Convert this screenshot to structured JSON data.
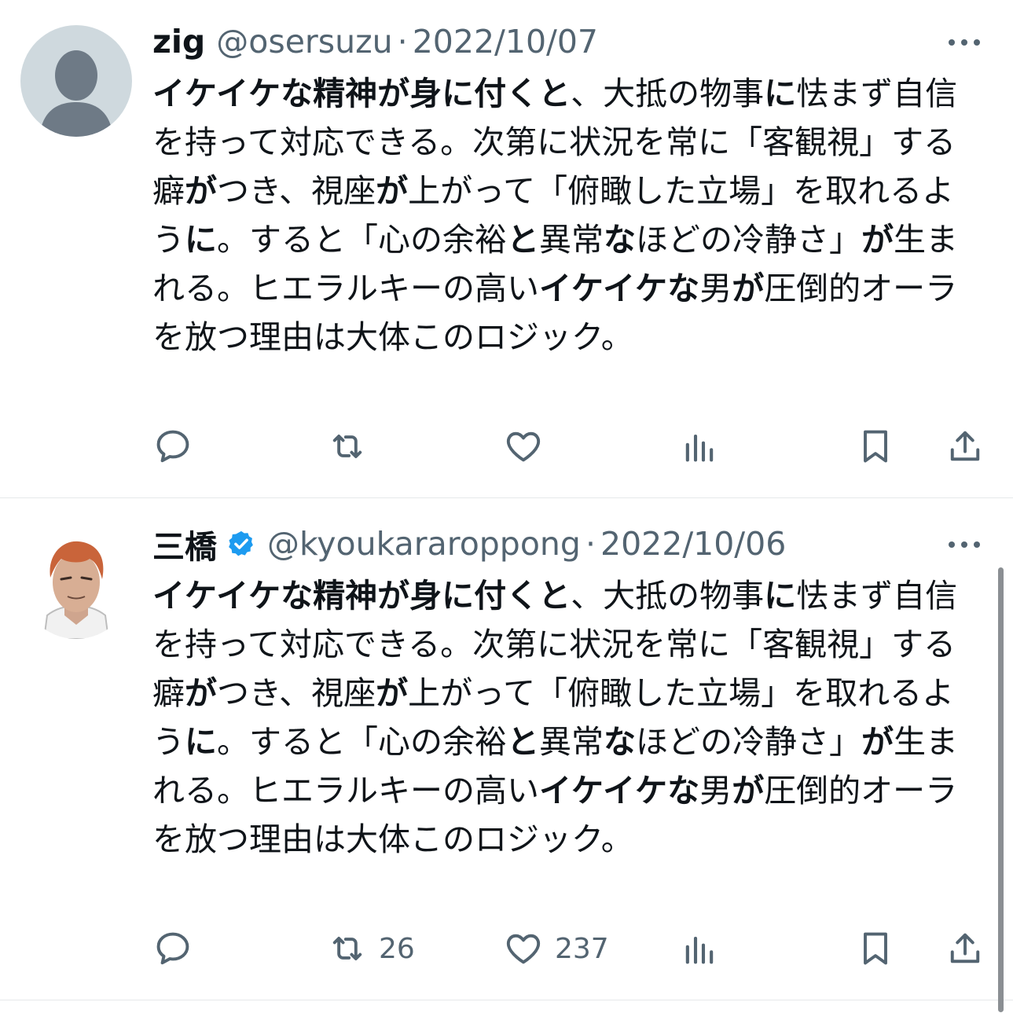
{
  "tweets": [
    {
      "name": "zig",
      "handle": "@osersuzu",
      "separator": "·",
      "date": "2022/10/07",
      "verified": false,
      "body": [
        {
          "t": "イケイケな精神が身に付くと",
          "b": true
        },
        {
          "t": "、大抵の物事",
          "b": false
        },
        {
          "t": "に",
          "b": true
        },
        {
          "t": "怯まず自信を持って対応できる。次第に状況を常に「客観視」する癖",
          "b": false
        },
        {
          "t": "が",
          "b": true
        },
        {
          "t": "つき、視座",
          "b": false
        },
        {
          "t": "が",
          "b": true
        },
        {
          "t": "上がって「俯瞰した立場」を取れるよう",
          "b": false
        },
        {
          "t": "に",
          "b": true
        },
        {
          "t": "。すると「心の余裕",
          "b": false
        },
        {
          "t": "と",
          "b": true
        },
        {
          "t": "異常",
          "b": false
        },
        {
          "t": "な",
          "b": true
        },
        {
          "t": "ほどの冷静さ」",
          "b": false
        },
        {
          "t": "が",
          "b": true
        },
        {
          "t": "生まれる。ヒエラルキーの高い",
          "b": false
        },
        {
          "t": "イケイケな",
          "b": true
        },
        {
          "t": "男",
          "b": false
        },
        {
          "t": "が",
          "b": true
        },
        {
          "t": "圧倒的オーラを放つ理由は大体このロジック。",
          "b": false
        }
      ],
      "actions": {
        "reply": "",
        "retweet": "",
        "like": "",
        "views": ""
      }
    },
    {
      "name": "三橋",
      "handle": "@kyoukararoppong",
      "separator": "·",
      "date": "2022/10/06",
      "verified": true,
      "body": [
        {
          "t": "イケイケな精神が身に付くと",
          "b": true
        },
        {
          "t": "、大抵の物事",
          "b": false
        },
        {
          "t": "に",
          "b": true
        },
        {
          "t": "怯まず自信を持って対応できる。次第に状況を常に「客観視」する癖",
          "b": false
        },
        {
          "t": "が",
          "b": true
        },
        {
          "t": "つき、視座",
          "b": false
        },
        {
          "t": "が",
          "b": true
        },
        {
          "t": "上がって「俯瞰した立場」を取れるよう",
          "b": false
        },
        {
          "t": "に",
          "b": true
        },
        {
          "t": "。すると「心の余裕",
          "b": false
        },
        {
          "t": "と",
          "b": true
        },
        {
          "t": "異常",
          "b": false
        },
        {
          "t": "な",
          "b": true
        },
        {
          "t": "ほどの冷静さ」",
          "b": false
        },
        {
          "t": "が",
          "b": true
        },
        {
          "t": "生まれる。ヒエラルキーの高い",
          "b": false
        },
        {
          "t": "イケイケな",
          "b": true
        },
        {
          "t": "男",
          "b": false
        },
        {
          "t": "が",
          "b": true
        },
        {
          "t": "圧倒的オーラを放つ理由は大体このロジック。",
          "b": false
        }
      ],
      "actions": {
        "reply": "",
        "retweet": "26",
        "like": "237",
        "views": ""
      }
    }
  ],
  "icons": [
    "more-icon",
    "reply-icon",
    "retweet-icon",
    "like-icon",
    "views-icon",
    "bookmark-icon",
    "share-icon",
    "verified-badge-icon",
    "default-avatar-icon"
  ],
  "colors": {
    "text": "#0f1419",
    "secondary": "#536471",
    "verified": "#1d9bf0",
    "divider": "#e6e8ea"
  }
}
